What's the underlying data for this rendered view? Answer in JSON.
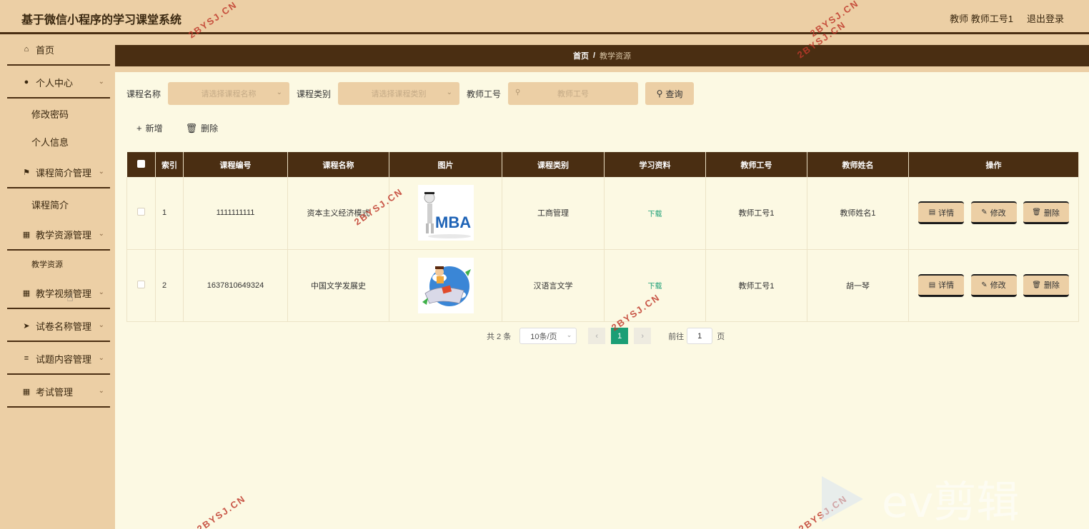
{
  "app": {
    "title": "基于微信小程序的学习课堂系统",
    "user": "教师 教师工号1",
    "logout": "退出登录"
  },
  "sidebar": {
    "items": [
      {
        "label": "首页",
        "icon": "home-icon"
      },
      {
        "label": "个人中心",
        "icon": "user-icon",
        "sub": [
          "修改密码",
          "个人信息"
        ]
      },
      {
        "label": "课程简介管理",
        "icon": "flag-icon",
        "sub": [
          "课程简介"
        ]
      },
      {
        "label": "教学资源管理",
        "icon": "grid-icon",
        "sub": [
          "教学资源"
        ]
      },
      {
        "label": "教学视频管理",
        "icon": "grid-icon"
      },
      {
        "label": "试卷名称管理",
        "icon": "send-icon"
      },
      {
        "label": "试题内容管理",
        "icon": "sliders-icon"
      },
      {
        "label": "考试管理",
        "icon": "grid-icon"
      }
    ]
  },
  "breadcrumb": {
    "home": "首页",
    "separator": "/",
    "current": "教学资源"
  },
  "search": {
    "course_name_label": "课程名称",
    "course_name_placeholder": "请选择课程名称",
    "course_type_label": "课程类别",
    "course_type_placeholder": "请选择课程类别",
    "teacher_id_label": "教师工号",
    "teacher_id_placeholder": "教师工号",
    "query_label": "查询"
  },
  "actions": {
    "add_label": "新增",
    "delete_label": "删除"
  },
  "table": {
    "columns": [
      "索引",
      "课程编号",
      "课程名称",
      "图片",
      "课程类别",
      "学习资料",
      "教师工号",
      "教师姓名",
      "操作"
    ],
    "rows": [
      {
        "index": "1",
        "course_code": "1111111111",
        "course_name": "资本主义经济模式",
        "image": "mba-image",
        "course_type": "工商管理",
        "material": "下载",
        "teacher_id": "教师工号1",
        "teacher_name": "教师姓名1"
      },
      {
        "index": "2",
        "course_code": "1637810649324",
        "course_name": "中国文学发展史",
        "image": "literature-image",
        "course_type": "汉语言文学",
        "material": "下载",
        "teacher_id": "教师工号1",
        "teacher_name": "胡一琴"
      }
    ],
    "ops": {
      "detail": "详情",
      "edit": "修改",
      "delete": "删除"
    }
  },
  "pagination": {
    "total": "共 2 条",
    "page_size": "10条/页",
    "current_page": "1",
    "goto_label": "前往",
    "goto_value": "1",
    "page_suffix": "页"
  },
  "watermark": "2BYSJ.CN",
  "ev_logo": "ev剪辑",
  "colors": {
    "topbar": "#eccfa5",
    "dark_brown": "#4a2e12",
    "content_bg": "#fcf9e3",
    "accent_green": "#1a9e75"
  }
}
